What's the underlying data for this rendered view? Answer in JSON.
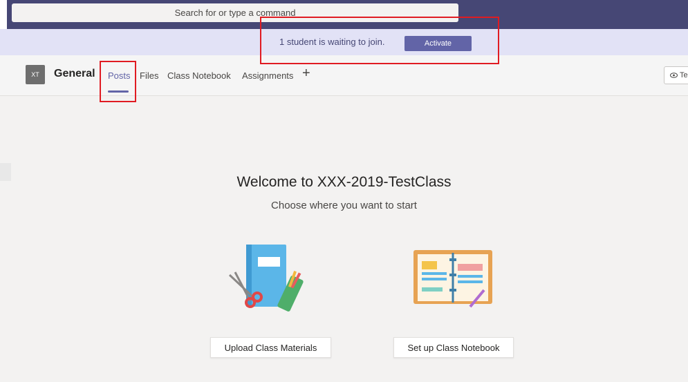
{
  "search": {
    "placeholder": "Search for or type a command"
  },
  "notification": {
    "message": "1 student is waiting to join.",
    "activate_label": "Activate"
  },
  "channel": {
    "avatar_initials": "XT",
    "name": "General",
    "tabs": [
      {
        "label": "Posts",
        "active": true
      },
      {
        "label": "Files",
        "active": false
      },
      {
        "label": "Class Notebook",
        "active": false
      },
      {
        "label": "Assignments",
        "active": false
      }
    ],
    "add_tab_symbol": "+",
    "team_button_label": "Te"
  },
  "welcome": {
    "title": "Welcome to XXX-2019-TestClass",
    "subtitle": "Choose where you want to start"
  },
  "actions": {
    "upload_label": "Upload Class Materials",
    "notebook_label": "Set up Class Notebook"
  },
  "colors": {
    "brand": "#6264a7",
    "topbar": "#464775",
    "annotation": "#e01b22"
  }
}
